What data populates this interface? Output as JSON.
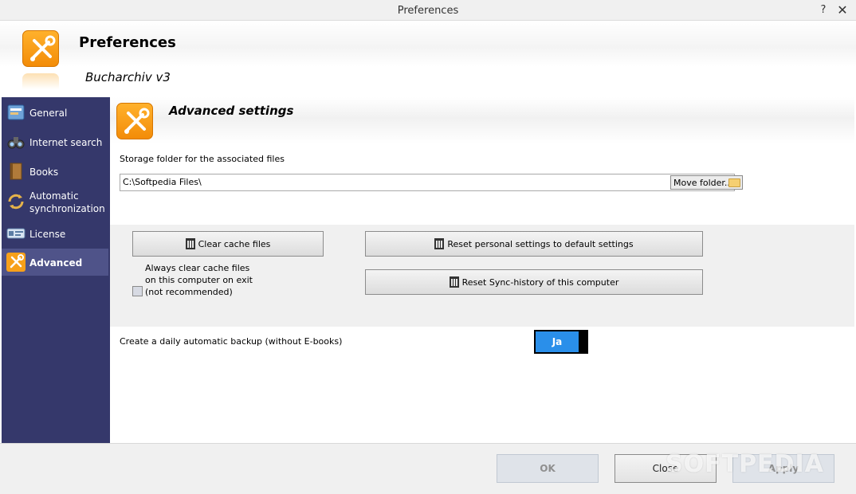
{
  "window": {
    "title": "Preferences",
    "help_glyph": "?",
    "close_glyph": "✕"
  },
  "header": {
    "title": "Preferences",
    "subtitle": "Bucharchiv v3",
    "icon": "tools-icon"
  },
  "sidebar": {
    "items": [
      {
        "label": "General",
        "icon": "general-icon",
        "active": false
      },
      {
        "label": "Internet search",
        "icon": "binoculars-icon",
        "active": false
      },
      {
        "label": "Books",
        "icon": "book-icon",
        "active": false
      },
      {
        "label": "Automatic synchronization",
        "line1": "Automatic",
        "line2": "synchronization",
        "icon": "sync-icon",
        "active": false
      },
      {
        "label": "License",
        "icon": "license-icon",
        "active": false
      },
      {
        "label": "Advanced",
        "icon": "tools-icon",
        "active": true
      }
    ]
  },
  "section": {
    "title": "Advanced settings",
    "storage_label": "Storage folder for the associated files",
    "storage_path": "C:\\Softpedia Files\\",
    "move_folder_label": "Move folder..",
    "clear_cache_label": "Clear cache files",
    "always_clear": {
      "line1": "Always clear cache files",
      "line2": "on this computer on exit",
      "line3": "(not recommended)",
      "checked": false
    },
    "reset_personal_label": "Reset personal settings to default settings",
    "reset_sync_label": "Reset Sync-history of this computer",
    "backup_label": "Create a daily automatic backup (without E-books)",
    "backup_toggle": "Ja"
  },
  "footer": {
    "ok_label": "OK",
    "close_label": "Close",
    "apply_label": "Apply"
  },
  "watermark": "SOFTPEDIA",
  "colors": {
    "sidebar": "#35386b",
    "sidebar_active": "#4f5389",
    "toggle_on": "#2a8fea",
    "icon_orange": "#f7a01a"
  }
}
